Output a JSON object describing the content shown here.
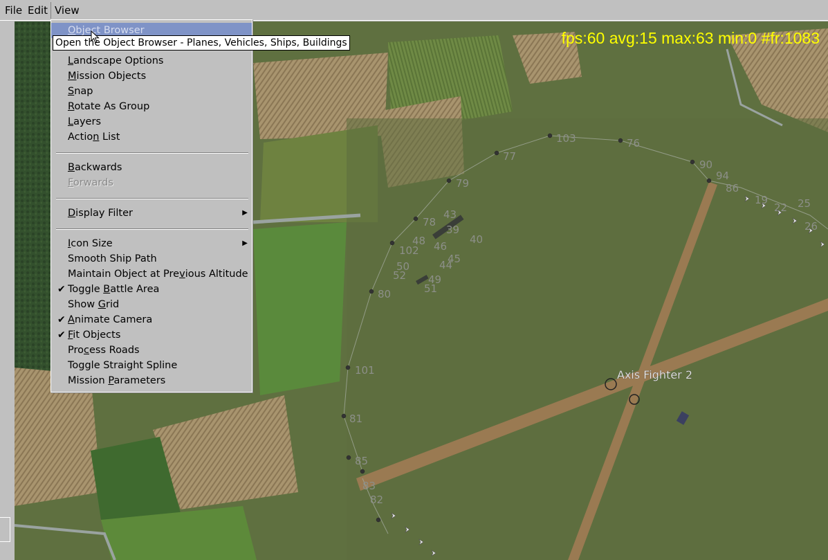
{
  "menubar": {
    "items": [
      {
        "label": "File"
      },
      {
        "label": "Edit"
      },
      {
        "label": "View"
      }
    ]
  },
  "view_menu": {
    "items": [
      {
        "label": "Object Browser",
        "mnemonic": "O",
        "state": "highlighted"
      },
      {
        "label": "Landscape Options",
        "mnemonic": "L"
      },
      {
        "label": "Mission Objects",
        "mnemonic": "M"
      },
      {
        "label": "Snap",
        "mnemonic": "S"
      },
      {
        "label": "Rotate As Group",
        "mnemonic": "R"
      },
      {
        "label": "Layers",
        "mnemonic": "L"
      },
      {
        "label": "Action List",
        "mnemonic": "n"
      },
      {
        "label": "Backwards",
        "mnemonic": "B"
      },
      {
        "label": "Forwards",
        "mnemonic": "F",
        "state": "disabled"
      },
      {
        "label": "Display Filter",
        "mnemonic": "D",
        "submenu": true
      },
      {
        "label": "Icon Size",
        "mnemonic": "I",
        "submenu": true
      },
      {
        "label": "Smooth Ship Path"
      },
      {
        "label": "Maintain Object at Previous Altitude",
        "mnemonic": "v"
      },
      {
        "label": "Toggle Battle Area",
        "mnemonic": "B",
        "checked": true
      },
      {
        "label": "Show Grid",
        "mnemonic": "G"
      },
      {
        "label": "Animate Camera",
        "mnemonic": "A",
        "checked": true
      },
      {
        "label": "Fit Objects",
        "mnemonic": "F",
        "checked": true
      },
      {
        "label": "Process Roads",
        "mnemonic": "c"
      },
      {
        "label": "Toggle Straight Spline"
      },
      {
        "label": "Mission Parameters",
        "mnemonic": "P"
      }
    ]
  },
  "tooltip": "Open the Object Browser - Planes, Vehicles, Ships, Buildings",
  "stats": "fps:60 avg:15 max:63 min:0 #fr:1083",
  "map": {
    "object_label": "Axis Fighter 2",
    "waypoints": [
      "103",
      "76",
      "77",
      "79",
      "90",
      "94",
      "86",
      "43",
      "78",
      "39",
      "48",
      "40",
      "102",
      "46",
      "45",
      "50",
      "52",
      "44",
      "49",
      "51",
      "80",
      "101",
      "81",
      "85",
      "83",
      "82",
      "19",
      "22",
      "25",
      "26"
    ],
    "colors": {
      "stats_text": "#ffff00",
      "menu_bg": "#c0c0c0",
      "highlight": "#7f93c7",
      "field_green": "#5d6e3f",
      "runway": "#9a7a52"
    }
  }
}
